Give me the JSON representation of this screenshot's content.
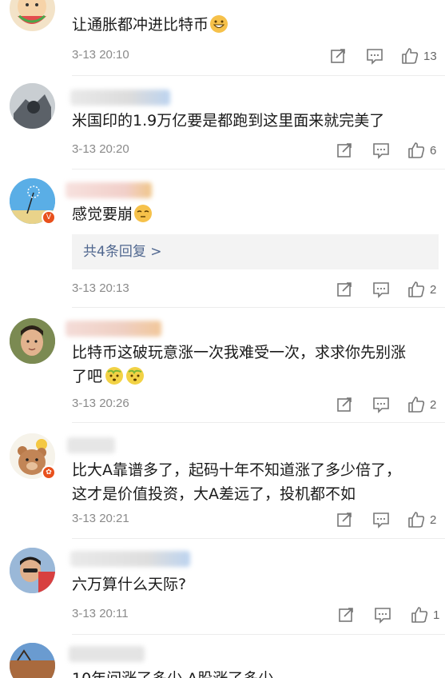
{
  "comments": [
    {
      "text": "让通胀都冲进比特币",
      "time": "3-13 20:10",
      "likes": "13"
    },
    {
      "text": "米国印的1.9万亿要是都跑到这里面来就完美了",
      "time": "3-13 20:20",
      "likes": "6"
    },
    {
      "text": "感觉要崩",
      "time": "3-13 20:13",
      "likes": "2",
      "replies_label": "共4条回复 >"
    },
    {
      "text_line1": "比特币这破玩意涨一次我难受一次，求求你先别涨",
      "text_line2": "了吧",
      "time": "3-13 20:26",
      "likes": "2"
    },
    {
      "text_line1": "比大A靠谱多了，起码十年不知道涨了多少倍了，",
      "text_line2": "这才是价值投资，大A差远了，投机都不如",
      "time": "3-13 20:21",
      "likes": "2"
    },
    {
      "text": "六万算什么天际?",
      "time": "3-13 20:11",
      "likes": "1"
    },
    {
      "text": "10年间涨了多少 A股涨了多少"
    }
  ],
  "icons": {
    "repost": "repost-icon",
    "comment": "comment-icon",
    "like": "thumbs-up-icon"
  },
  "colors": {
    "time": "#8a8a8a",
    "replies_link": "#50678f",
    "verified_badge": "#e8501c"
  }
}
